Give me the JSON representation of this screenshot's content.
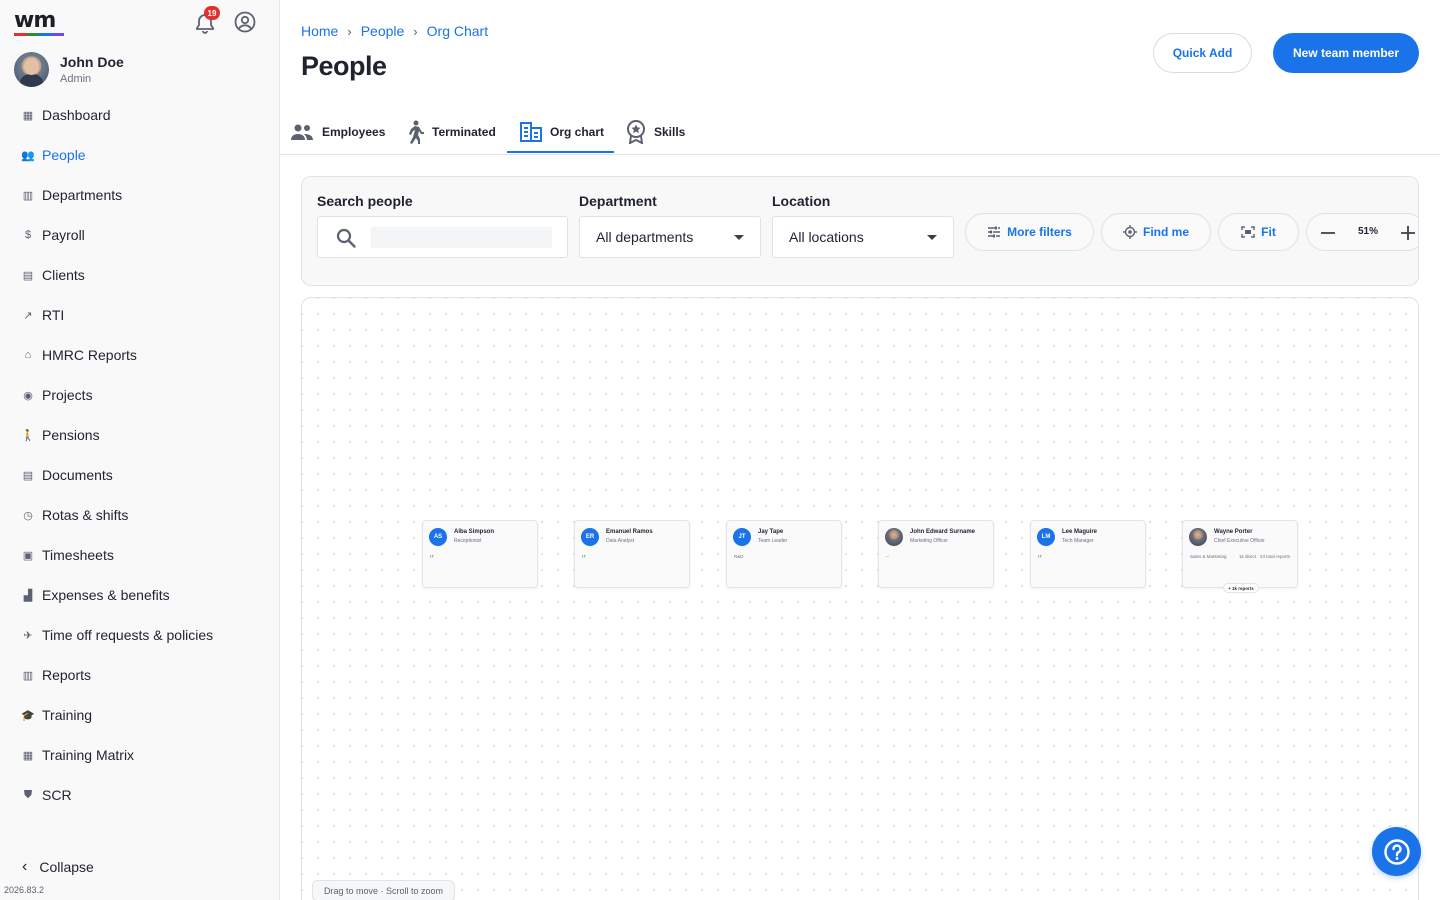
{
  "app": {
    "logo_text": "wm",
    "logo_colors": [
      "#e03131",
      "#2b8a3e",
      "#1a73e8",
      "#7048e8"
    ],
    "notification_count": "19",
    "version": "2026.83.2"
  },
  "user": {
    "name": "John Doe",
    "role": "Admin"
  },
  "sidebar": {
    "items": [
      {
        "label": "Dashboard",
        "icon": "dashboard-icon",
        "glyph": "▦"
      },
      {
        "label": "People",
        "icon": "people-icon",
        "glyph": "👥"
      },
      {
        "label": "Departments",
        "icon": "departments-icon",
        "glyph": "▥"
      },
      {
        "label": "Payroll",
        "icon": "dollar-icon",
        "glyph": "$"
      },
      {
        "label": "Clients",
        "icon": "clients-icon",
        "glyph": "▤"
      },
      {
        "label": "RTI",
        "icon": "trend-icon",
        "glyph": "↗"
      },
      {
        "label": "HMRC Reports",
        "icon": "bank-icon",
        "glyph": "⌂"
      },
      {
        "label": "Projects",
        "icon": "projects-icon",
        "glyph": "◉"
      },
      {
        "label": "Pensions",
        "icon": "pensions-icon",
        "glyph": "🚶"
      },
      {
        "label": "Documents",
        "icon": "documents-icon",
        "glyph": "▤"
      },
      {
        "label": "Rotas & shifts",
        "icon": "clock-icon",
        "glyph": "◷"
      },
      {
        "label": "Timesheets",
        "icon": "calendar-icon",
        "glyph": "▣"
      },
      {
        "label": "Expenses & benefits",
        "icon": "expenses-icon",
        "glyph": "▟"
      },
      {
        "label": "Time off requests & policies",
        "icon": "plane-icon",
        "glyph": "✈"
      },
      {
        "label": "Reports",
        "icon": "reports-icon",
        "glyph": "▥"
      },
      {
        "label": "Training",
        "icon": "graduation-icon",
        "glyph": "🎓"
      },
      {
        "label": "Training Matrix",
        "icon": "matrix-icon",
        "glyph": "▦"
      },
      {
        "label": "SCR",
        "icon": "shield-icon",
        "glyph": "⛊"
      }
    ],
    "active_index": 1,
    "collapse_label": "Collapse"
  },
  "breadcrumb": [
    "Home",
    "People",
    "Org Chart"
  ],
  "page": {
    "title": "People"
  },
  "actions": {
    "quick_add": "Quick Add",
    "new_member": "New team member"
  },
  "tabs": [
    {
      "label": "Employees",
      "icon": "people-icon"
    },
    {
      "label": "Terminated",
      "icon": "walking-icon"
    },
    {
      "label": "Org chart",
      "icon": "org-chart-icon"
    },
    {
      "label": "Skills",
      "icon": "badge-icon"
    }
  ],
  "active_tab": "Org chart",
  "filters": {
    "search_label": "Search people",
    "search_value": "",
    "department_label": "Department",
    "department_value": "All departments",
    "location_label": "Location",
    "location_value": "All locations",
    "more_filters": "More filters",
    "find_me": "Find me",
    "fit": "Fit",
    "zoom_level": "51%"
  },
  "org_chart": {
    "cards": [
      {
        "initials": "AS",
        "name": "Alba Simpson",
        "title": "Receptionist",
        "department": "IT",
        "photo": false
      },
      {
        "initials": "ER",
        "name": "Emanuel Ramos",
        "title": "Data Analyst",
        "department": "IT",
        "photo": false
      },
      {
        "initials": "JT",
        "name": "Jay Tape",
        "title": "Team Leader",
        "department": "R&D",
        "photo": false
      },
      {
        "initials": "",
        "name": "John Edward Surname",
        "title": "Marketing Officer",
        "department": "--",
        "photo": true
      },
      {
        "initials": "LM",
        "name": "Lee Maguire",
        "title": "Tech Manager",
        "department": "IT",
        "photo": false
      },
      {
        "initials": "",
        "name": "Wayne Porter",
        "title": "Chief Executive Officer",
        "department": "Sales & Marketing",
        "reports": "1k direct · 24 total reports",
        "expand": "+ 1k reports",
        "photo": true
      }
    ],
    "hint": "Drag to move · Scroll to zoom"
  },
  "colors": {
    "accent": "#1a73e8",
    "badge": "#e03131"
  }
}
